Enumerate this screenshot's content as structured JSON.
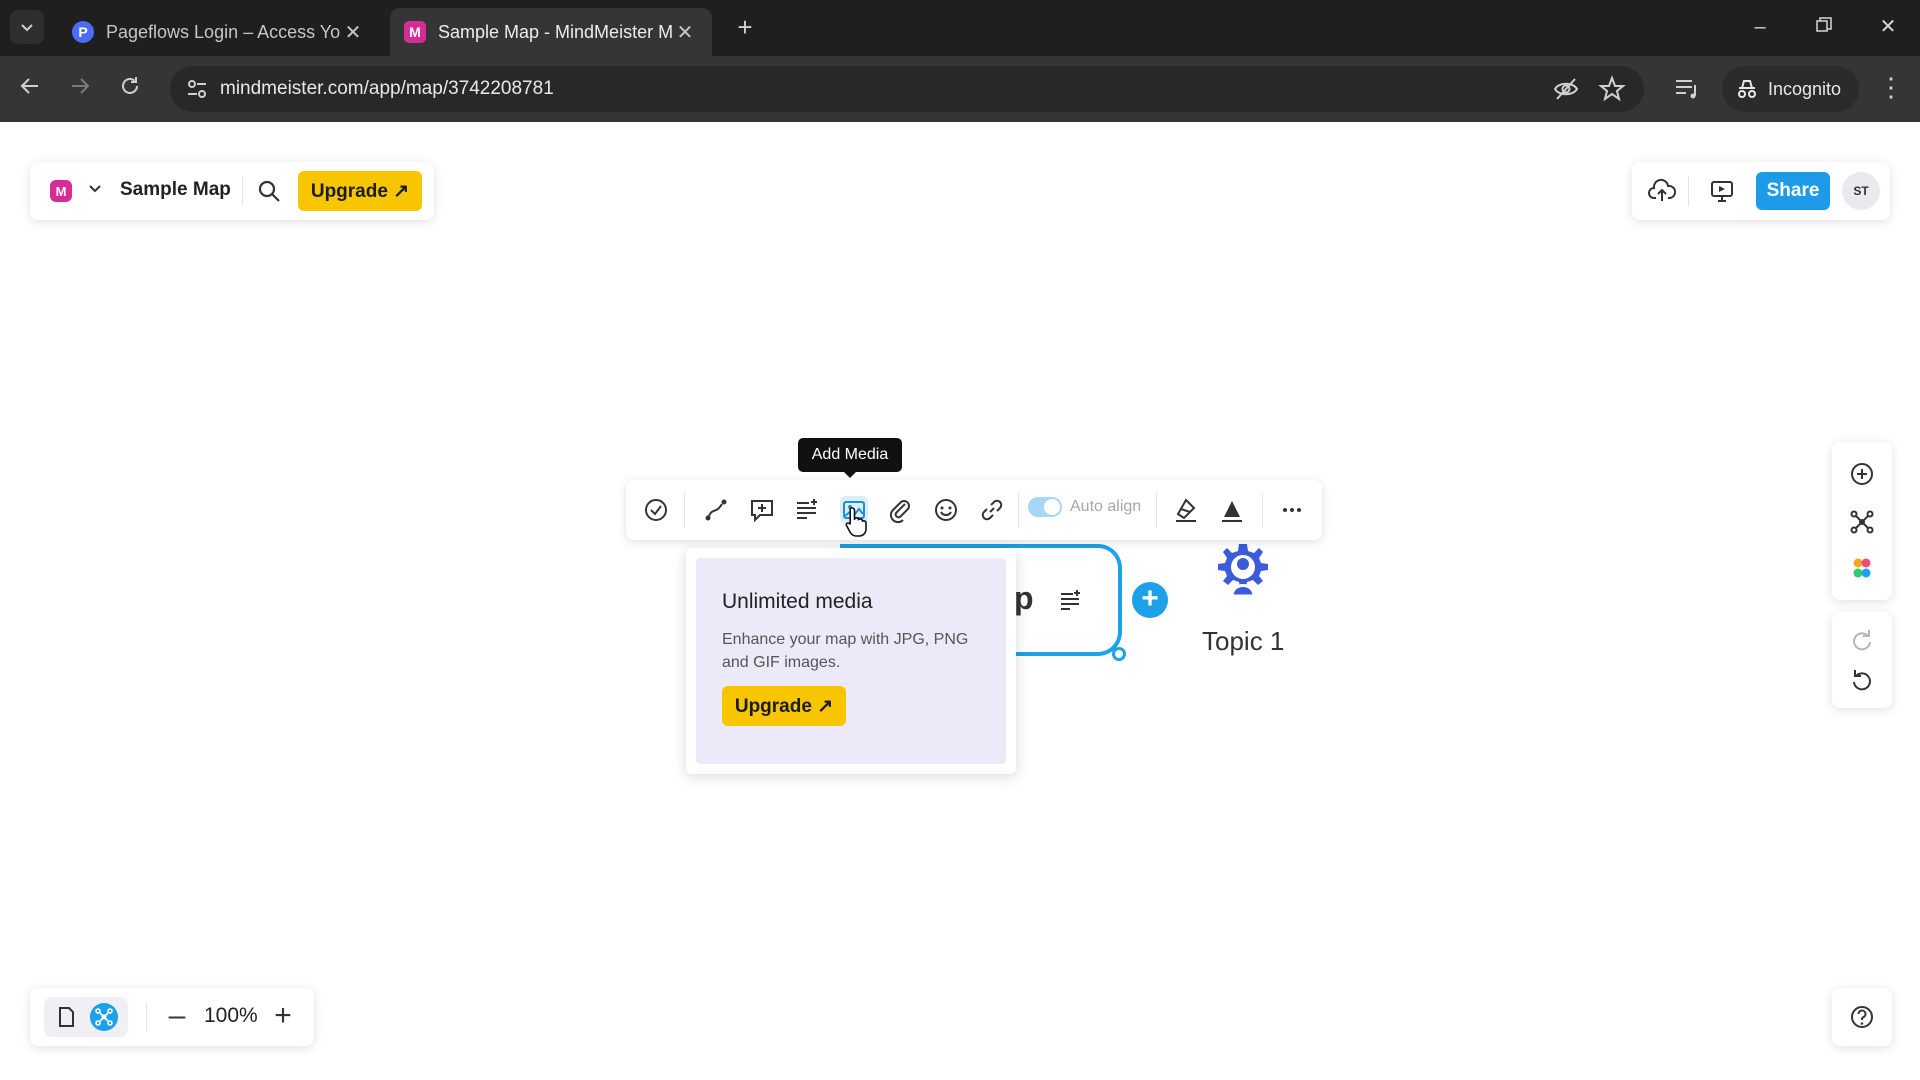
{
  "browser": {
    "tabs": [
      {
        "favicon": "P",
        "favicon_color": "#4a6cf7",
        "title": "Pageflows Login – Access Your",
        "active": false
      },
      {
        "favicon": "M",
        "favicon_color": "#d62c96",
        "title": "Sample Map - MindMeister Mi",
        "active": true
      }
    ],
    "url": "mindmeister.com/app/map/3742208781",
    "incognito_label": "Incognito"
  },
  "header": {
    "logo_letter": "M",
    "map_title": "Sample Map",
    "upgrade_label": "Upgrade ↗"
  },
  "top_right": {
    "share_label": "Share",
    "avatar_initials": "ST"
  },
  "node_toolbar": {
    "tooltip": "Add Media",
    "auto_align_label": "Auto align",
    "auto_align_on": true,
    "active_tool": "add-media"
  },
  "media_popup": {
    "title": "Unlimited media",
    "description": "Enhance your map with JPG, PNG and GIF images.",
    "upgrade_label": "Upgrade ↗"
  },
  "map": {
    "central_fragment": "p",
    "topic_label": "Topic 1",
    "accent_color": "#1da1e8"
  },
  "zoom": {
    "value": "100%",
    "minus": "–",
    "plus": "+"
  },
  "colors": {
    "brand": "#d62c96",
    "upgrade": "#f7c600",
    "share": "#1d9be8",
    "topic_icon": "#3b5bdb"
  }
}
